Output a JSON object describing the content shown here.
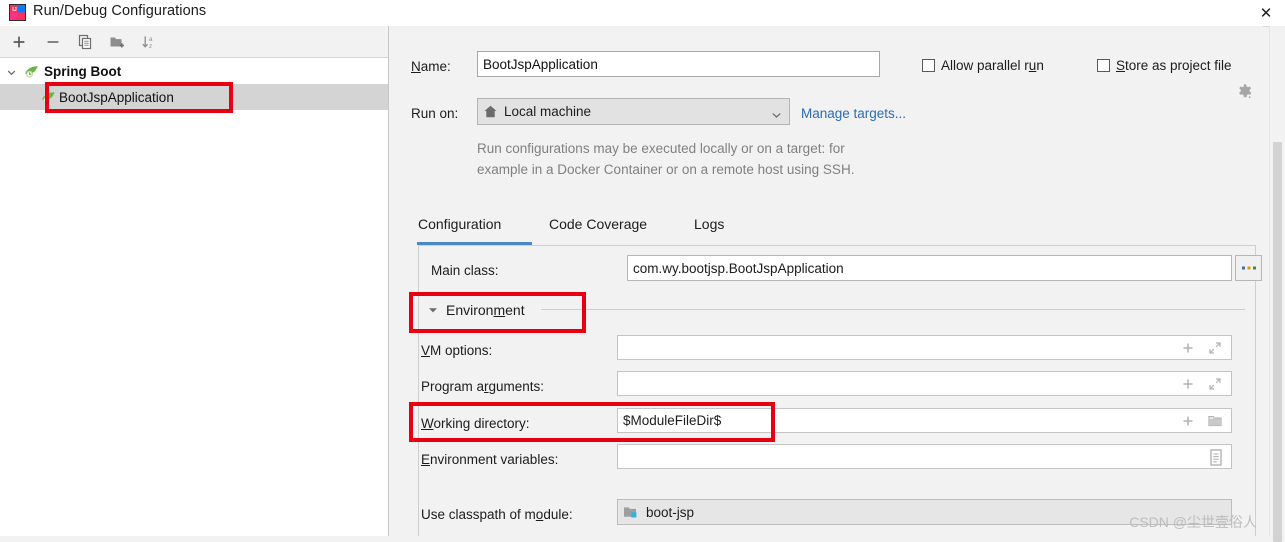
{
  "window": {
    "title": "Run/Debug Configurations",
    "close_label": "✕",
    "app_icon": "intellij-idea-icon"
  },
  "left_panel": {
    "toolbar": [
      {
        "name": "add-configuration-button",
        "icon": "plus-icon",
        "label": "+"
      },
      {
        "name": "remove-configuration-button",
        "icon": "minus-icon",
        "label": "−"
      },
      {
        "name": "copy-configuration-button",
        "icon": "copy-icon",
        "label": ""
      },
      {
        "name": "new-folder-button",
        "icon": "new-folder-icon",
        "label": ""
      },
      {
        "name": "sort-configurations-button",
        "icon": "sort-alpha-icon",
        "label": ""
      }
    ],
    "tree": {
      "group": {
        "label": "Spring Boot",
        "icon": "spring-boot-icon",
        "expanded": true
      },
      "items": [
        {
          "label": "BootJspApplication",
          "icon": "spring-boot-icon",
          "selected": true
        }
      ]
    }
  },
  "form": {
    "name_label": "Name:",
    "name_mnemonic": "N",
    "name_value": "BootJspApplication",
    "run_on_label": "Run on:",
    "run_on_value": "Local machine",
    "run_on_icon": "home-icon",
    "manage_targets_link": "Manage targets...",
    "allow_parallel_run": {
      "label": "Allow parallel run",
      "mnemonic": "u",
      "checked": false
    },
    "store_as_project_file": {
      "label": "Store as project file",
      "mnemonic": "S",
      "checked": false
    },
    "settings_gear_icon": "gear-dropdown-icon",
    "description_line1": "Run configurations may be executed locally or on a target: for",
    "description_line2": "example in a Docker Container or on a remote host using SSH."
  },
  "tabs": {
    "items": [
      {
        "label": "Configuration",
        "active": true
      },
      {
        "label": "Code Coverage",
        "active": false
      },
      {
        "label": "Logs",
        "active": false
      }
    ],
    "accent_color": "#4a88c7"
  },
  "configuration": {
    "main_class": {
      "label": "Main class:",
      "value": "com.wy.bootjsp.BootJspApplication",
      "browse_button_label": "...",
      "browse_button_name": "browse-main-class-button"
    },
    "environment_section": {
      "label": "Environment",
      "mnemonic": "m",
      "expanded": true,
      "collapse_icon": "chevron-down-icon"
    },
    "vm_options": {
      "label": "VM options:",
      "mnemonic": "V",
      "value": "",
      "icons": [
        "plus-icon",
        "expand-icon"
      ]
    },
    "program_arguments": {
      "label": "Program arguments:",
      "mnemonic": "r",
      "value": "",
      "icons": [
        "plus-icon",
        "expand-icon"
      ]
    },
    "working_directory": {
      "label": "Working directory:",
      "mnemonic": "W",
      "value": "$ModuleFileDir$",
      "icons": [
        "plus-icon",
        "folder-icon"
      ]
    },
    "environment_variables": {
      "label": "Environment variables:",
      "mnemonic": "E",
      "value": "",
      "icons": [
        "list-document-icon"
      ]
    },
    "use_classpath_of_module": {
      "label": "Use classpath of module:",
      "mnemonic": "o",
      "value": "boot-jsp",
      "icon": "module-folder-icon"
    }
  },
  "annotations": {
    "highlight_color": "#e60012",
    "boxes": [
      {
        "name": "highlight-boot-jsp-application"
      },
      {
        "name": "highlight-environment-section"
      },
      {
        "name": "highlight-working-directory"
      }
    ]
  },
  "watermark": {
    "text": "CSDN @尘世壹俗人"
  }
}
